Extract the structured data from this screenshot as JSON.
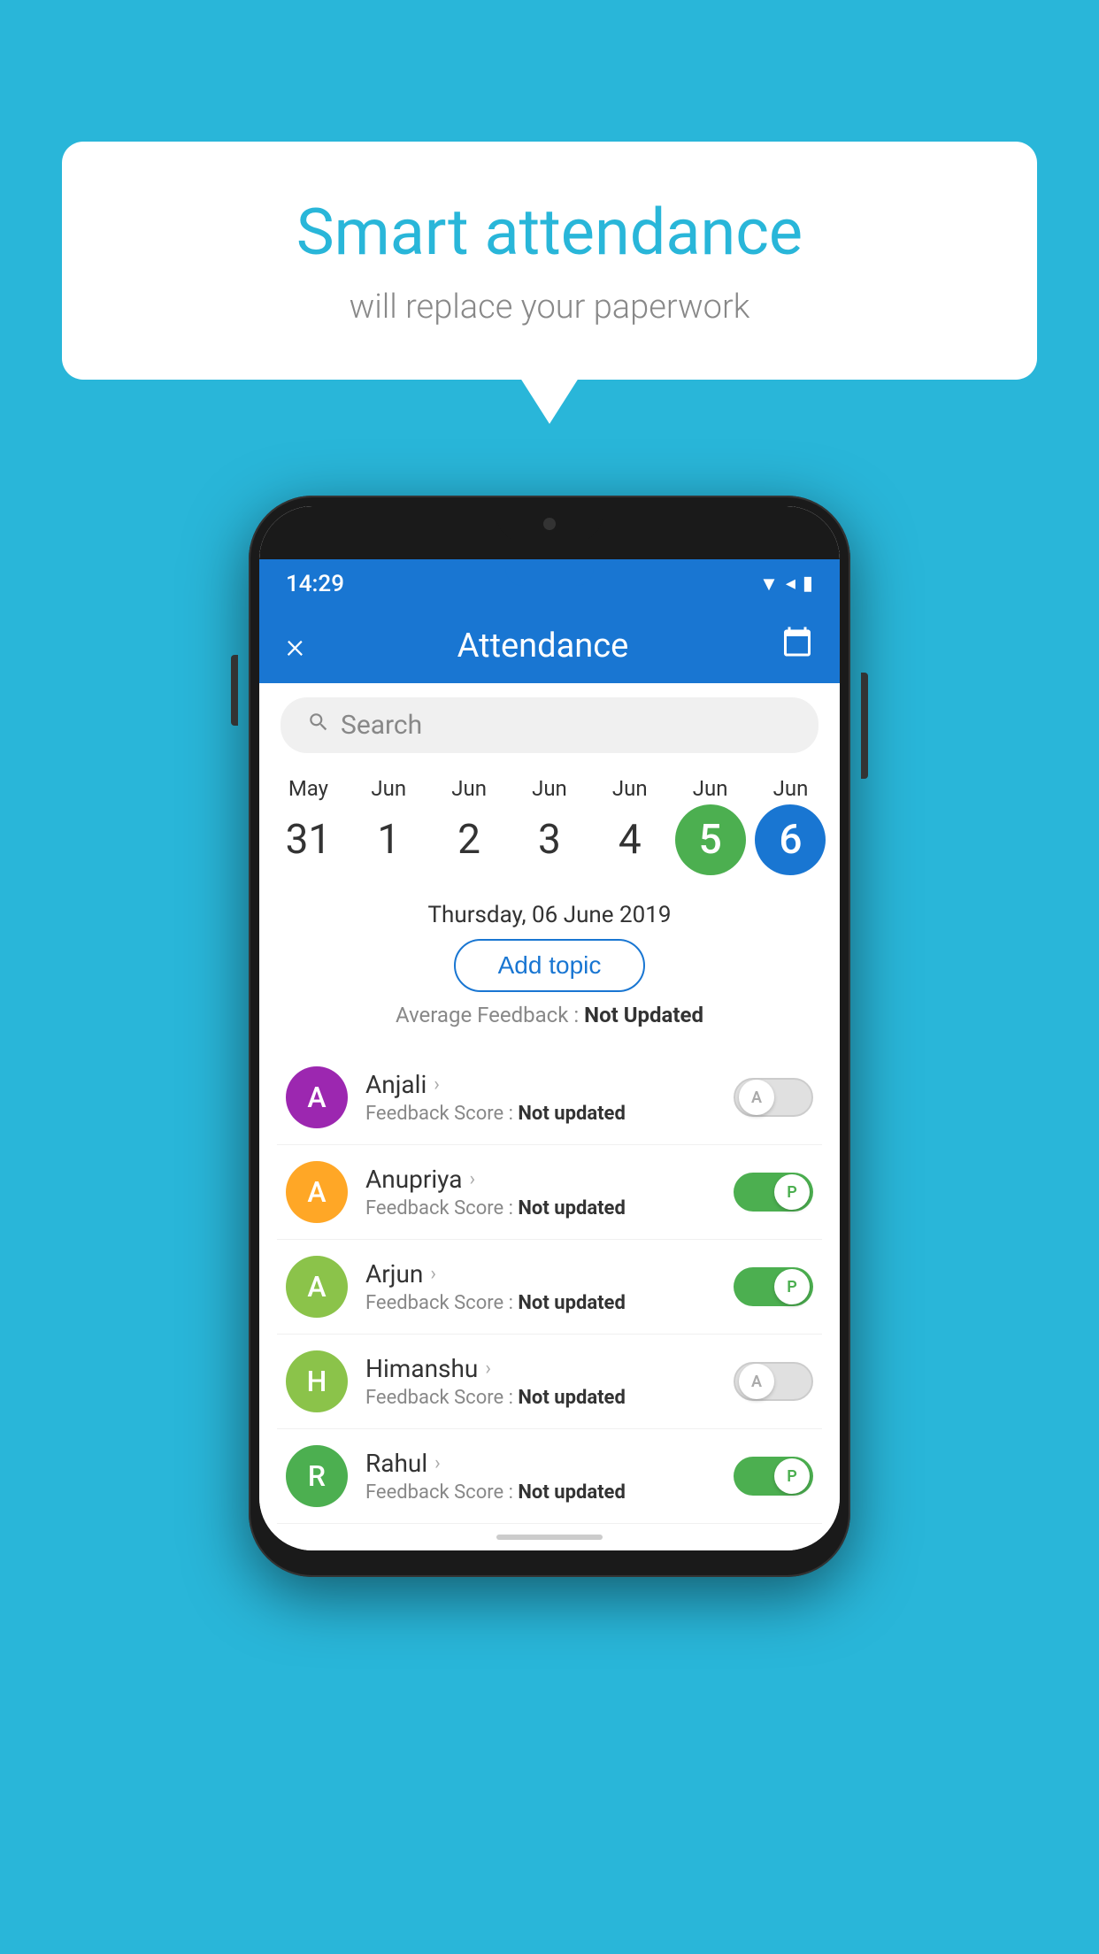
{
  "background": {
    "color": "#29B6D9"
  },
  "speech_bubble": {
    "title": "Smart attendance",
    "subtitle": "will replace your paperwork"
  },
  "status_bar": {
    "time": "14:29",
    "icons": [
      "wifi",
      "signal",
      "battery"
    ]
  },
  "toolbar": {
    "close_label": "×",
    "title": "Attendance",
    "calendar_icon": "📅"
  },
  "search": {
    "placeholder": "Search"
  },
  "dates": [
    {
      "month": "May",
      "day": "31",
      "state": "normal"
    },
    {
      "month": "Jun",
      "day": "1",
      "state": "normal"
    },
    {
      "month": "Jun",
      "day": "2",
      "state": "normal"
    },
    {
      "month": "Jun",
      "day": "3",
      "state": "normal"
    },
    {
      "month": "Jun",
      "day": "4",
      "state": "normal"
    },
    {
      "month": "Jun",
      "day": "5",
      "state": "today"
    },
    {
      "month": "Jun",
      "day": "6",
      "state": "selected"
    }
  ],
  "selected_date": {
    "text": "Thursday, 06 June 2019",
    "add_topic_label": "Add topic",
    "feedback_label": "Average Feedback : ",
    "feedback_value": "Not Updated"
  },
  "students": [
    {
      "name": "Anjali",
      "initial": "A",
      "avatar_color": "#9C27B0",
      "feedback_label": "Feedback Score : ",
      "feedback_value": "Not updated",
      "attendance": "A",
      "toggle_state": "off"
    },
    {
      "name": "Anupriya",
      "initial": "A",
      "avatar_color": "#FFA726",
      "feedback_label": "Feedback Score : ",
      "feedback_value": "Not updated",
      "attendance": "P",
      "toggle_state": "on"
    },
    {
      "name": "Arjun",
      "initial": "A",
      "avatar_color": "#8BC34A",
      "feedback_label": "Feedback Score : ",
      "feedback_value": "Not updated",
      "attendance": "P",
      "toggle_state": "on"
    },
    {
      "name": "Himanshu",
      "initial": "H",
      "avatar_color": "#8BC34A",
      "feedback_label": "Feedback Score : ",
      "feedback_value": "Not updated",
      "attendance": "A",
      "toggle_state": "off"
    },
    {
      "name": "Rahul",
      "initial": "R",
      "avatar_color": "#4CAF50",
      "feedback_label": "Feedback Score : ",
      "feedback_value": "Not updated",
      "attendance": "P",
      "toggle_state": "on"
    }
  ]
}
